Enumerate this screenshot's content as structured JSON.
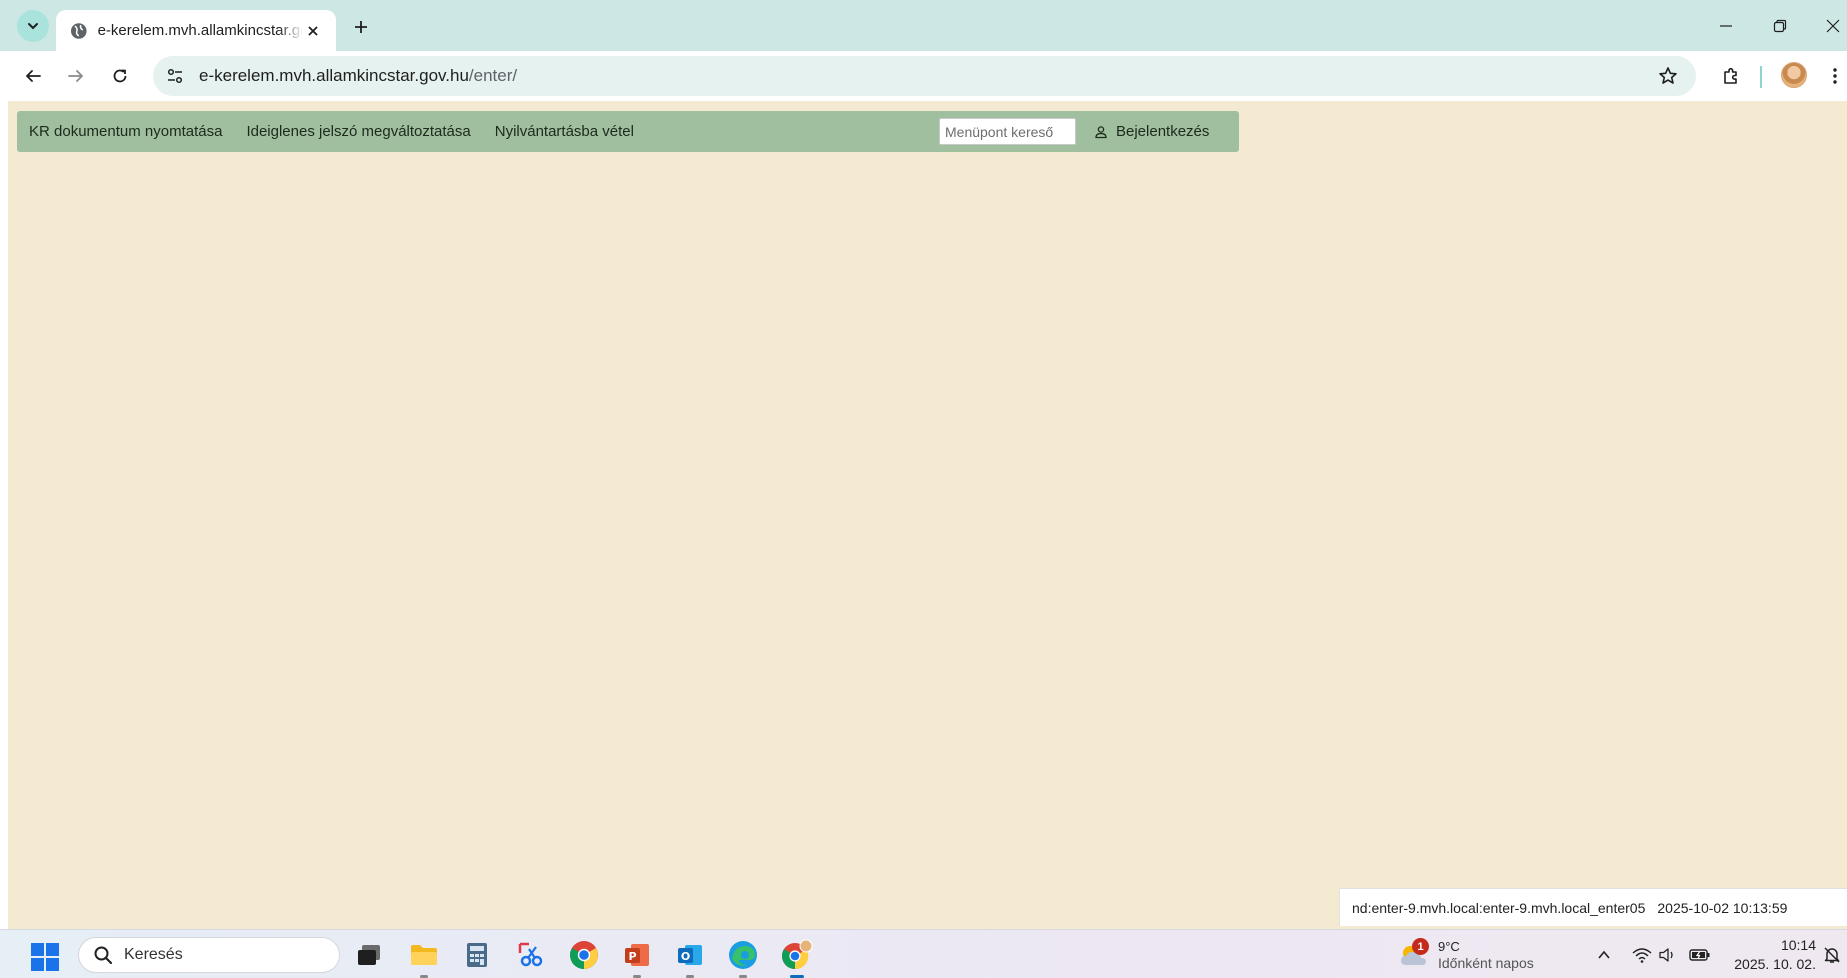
{
  "browser": {
    "tab_title": "e-kerelem.mvh.allamkincstar.gov.hu/enter/",
    "url_host": "e-kerelem.mvh.allamkincstar.gov.hu",
    "url_path": "/enter/"
  },
  "menu": {
    "items": [
      {
        "label": "KR dokumentum nyomtatása"
      },
      {
        "label": "Ideiglenes jelszó megváltoztatása"
      },
      {
        "label": "Nyilvántartásba vétel"
      }
    ],
    "search_placeholder": "Menüpont kereső",
    "login_label": "Bejelentkezés"
  },
  "status": {
    "node": "nd:enter-9.mvh.local:enter-9.mvh.local_enter05",
    "timestamp": "2025-10-02 10:13:59"
  },
  "taskbar": {
    "search_placeholder": "Keresés",
    "weather_badge": "1",
    "weather_temp": "9°C",
    "weather_condition": "Időnként napos",
    "time": "10:14",
    "date": "2025. 10. 02."
  },
  "colors": {
    "page_background": "#f4ead1",
    "menubar_background": "#9fbf9e",
    "tabstrip_background": "#cde8e4"
  }
}
